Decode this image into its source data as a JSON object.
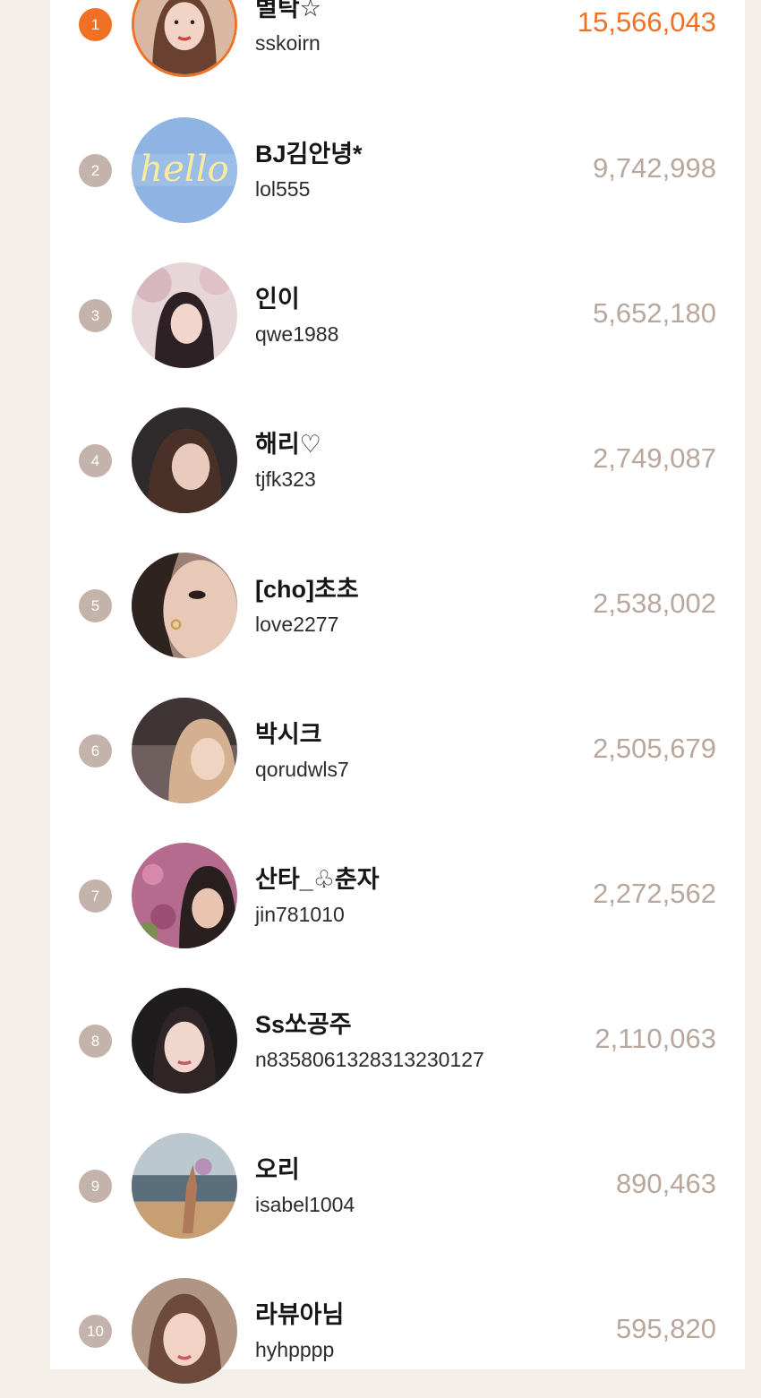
{
  "ranking": [
    {
      "rank": "1",
      "name": "별탁☆",
      "id": "sskoirn",
      "score": "15,566,043",
      "avatar_icon": "profile-photo-woman",
      "bg": "#d8b7a3",
      "fg": "#6a4030"
    },
    {
      "rank": "2",
      "name": "BJ김안녕*",
      "id": "lol555",
      "score": "9,742,998",
      "avatar_icon": "hello-neon-sign",
      "bg": "#8fb3e3",
      "fg": "#f3e69b"
    },
    {
      "rank": "3",
      "name": "인이",
      "id": "qwe1988",
      "score": "5,652,180",
      "avatar_icon": "profile-photo-woman",
      "bg": "#d9c2c5",
      "fg": "#2d2125"
    },
    {
      "rank": "4",
      "name": "해리♡",
      "id": "tjfk323",
      "score": "2,749,087",
      "avatar_icon": "profile-photo-woman",
      "bg": "#2f2b2c",
      "fg": "#e1c2b3"
    },
    {
      "rank": "5",
      "name": "[cho]초초",
      "id": "love2277",
      "score": "2,538,002",
      "avatar_icon": "profile-photo-woman",
      "bg": "#9b8175",
      "fg": "#e8c8b6"
    },
    {
      "rank": "6",
      "name": "박시크",
      "id": "qorudwls7",
      "score": "2,505,679",
      "avatar_icon": "profile-photo-man",
      "bg": "#6f5f5e",
      "fg": "#d5b090"
    },
    {
      "rank": "7",
      "name": "산타_♧춘자",
      "id": "jin781010",
      "score": "2,272,562",
      "avatar_icon": "profile-photo-woman",
      "bg": "#b46b8e",
      "fg": "#e8c4b1"
    },
    {
      "rank": "8",
      "name": "Ss쏘공주",
      "id": "n8358061328313230127",
      "score": "2,110,063",
      "avatar_icon": "profile-photo-woman",
      "bg": "#1f1c1d",
      "fg": "#f0d6cd"
    },
    {
      "rank": "9",
      "name": "오리",
      "id": "isabel1004",
      "score": "890,463",
      "avatar_icon": "beach-photo",
      "bg": "#c89f72",
      "fg": "#5a6e7c"
    },
    {
      "rank": "10",
      "name": "라뷰아님",
      "id": "hyhpppp",
      "score": "595,820",
      "avatar_icon": "profile-photo-woman",
      "bg": "#b09484",
      "fg": "#f1d3c6"
    }
  ],
  "colors": {
    "accent": "#f07124",
    "rank_badge": "#c3b3ab",
    "score_text": "#b9a79d",
    "page_bg": "#f4efe9"
  }
}
